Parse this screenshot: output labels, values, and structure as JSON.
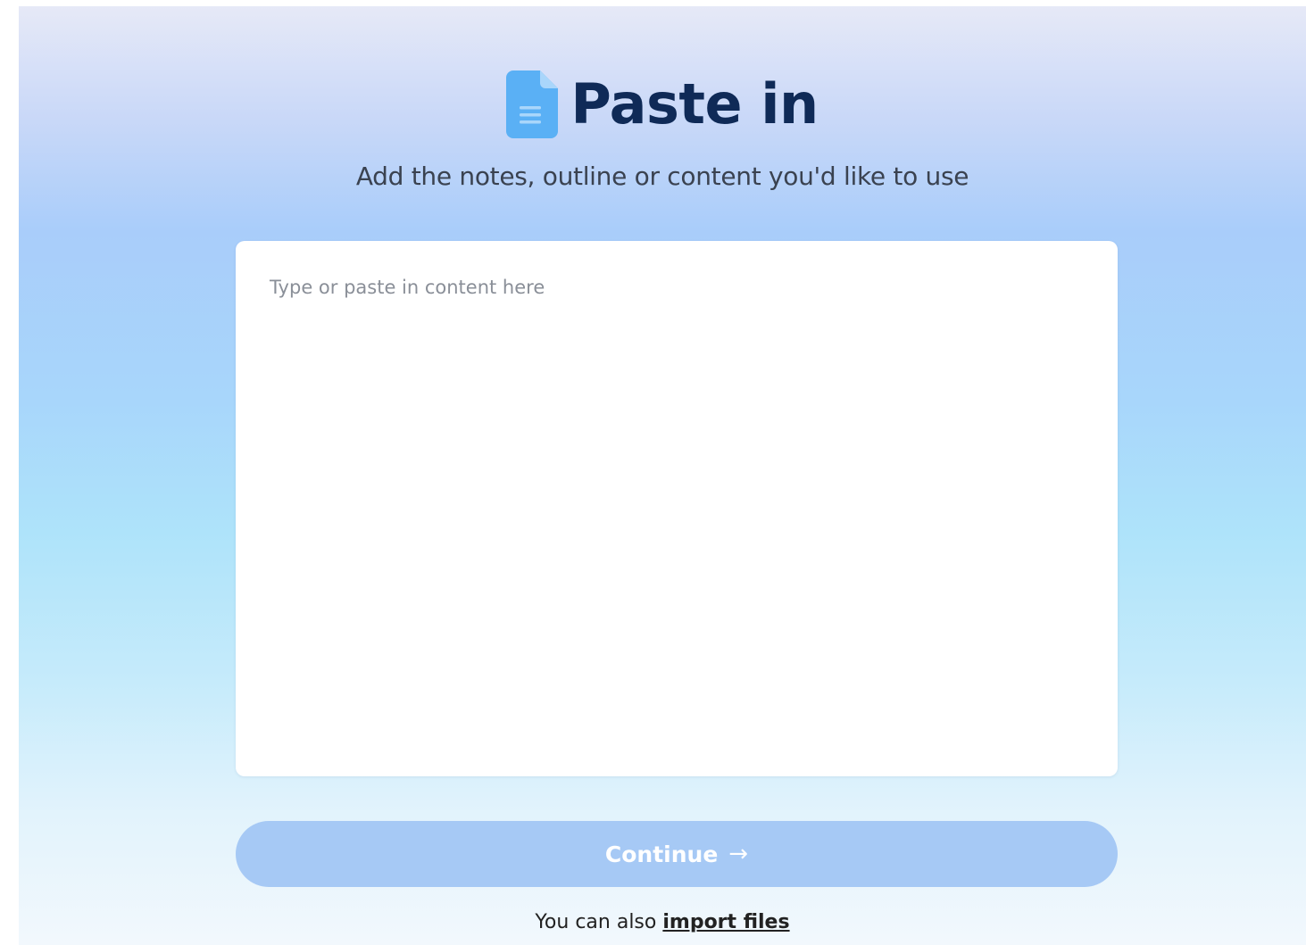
{
  "header": {
    "icon": "document-icon",
    "icon_color": "#5ab0f5",
    "title": "Paste in",
    "subtitle": "Add the notes, outline or content you'd like to use"
  },
  "editor": {
    "value": "",
    "placeholder": "Type or paste in content here"
  },
  "actions": {
    "continue_label": "Continue",
    "continue_icon": "arrow-right-icon",
    "continue_color": "#a6c9f5",
    "continue_disabled": true
  },
  "footer": {
    "prefix": "You can also",
    "link_label": "import files"
  },
  "colors": {
    "title": "#0f2a57",
    "background_top": "#e6e9f7",
    "background_mid": "#a8d6fb",
    "background_bottom": "#f2f8fd"
  }
}
